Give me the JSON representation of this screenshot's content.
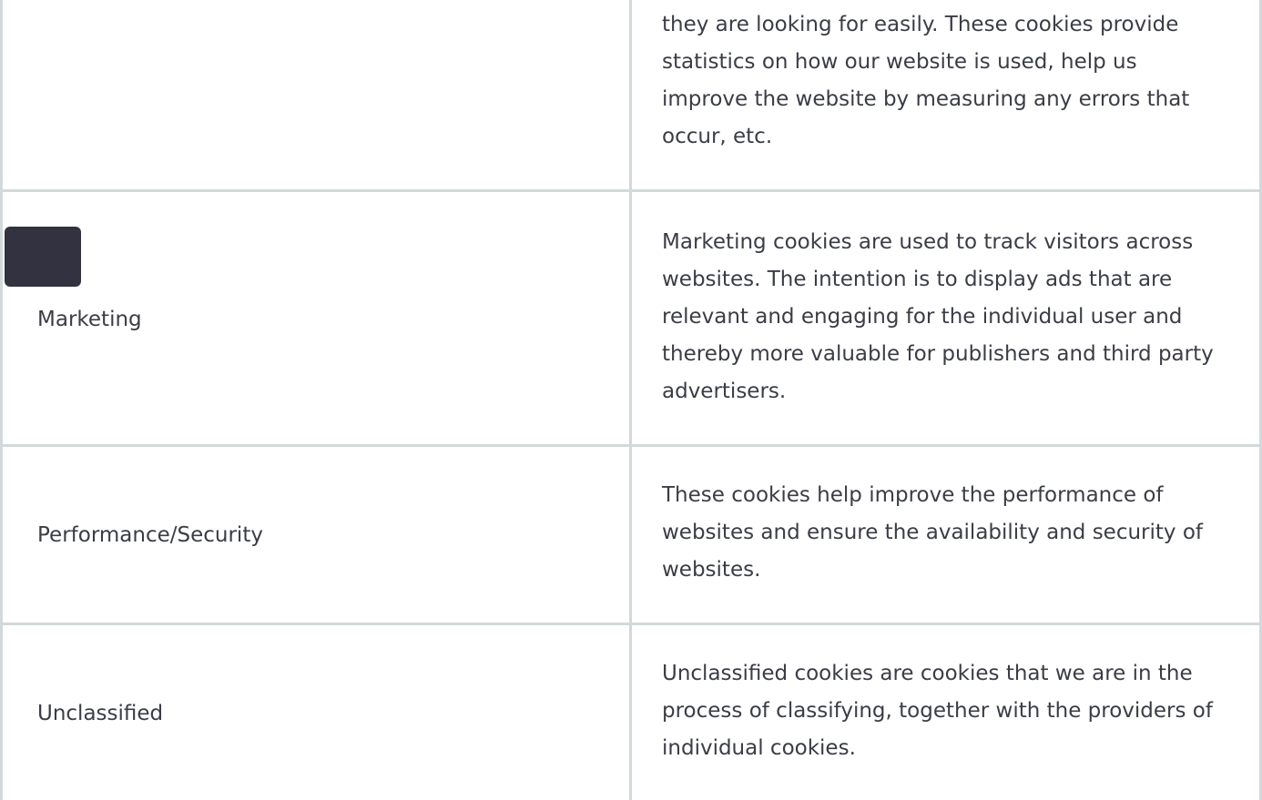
{
  "rows": [
    {
      "label": "",
      "description": "they are looking for easily. These cookies provide statistics on how our website is used, help us improve the website by measuring any errors that occur, etc."
    },
    {
      "label": "Marketing",
      "description": "Marketing cookies are used to track visitors across websites. The intention is to display ads that are relevant and engaging for the individual user and thereby more valuable for publishers and third party advertisers."
    },
    {
      "label": "Performance/Security",
      "description": "These cookies help improve the performance of websites and ensure the availability and security of websites."
    },
    {
      "label": "Unclassified",
      "description": "Unclassified cookies are cookies that we are in the process of classifying, together with the providers of individual cookies."
    }
  ],
  "colors": {
    "border": "#d3d9da",
    "text": "#3b3d46",
    "floating_button": "#323240"
  }
}
